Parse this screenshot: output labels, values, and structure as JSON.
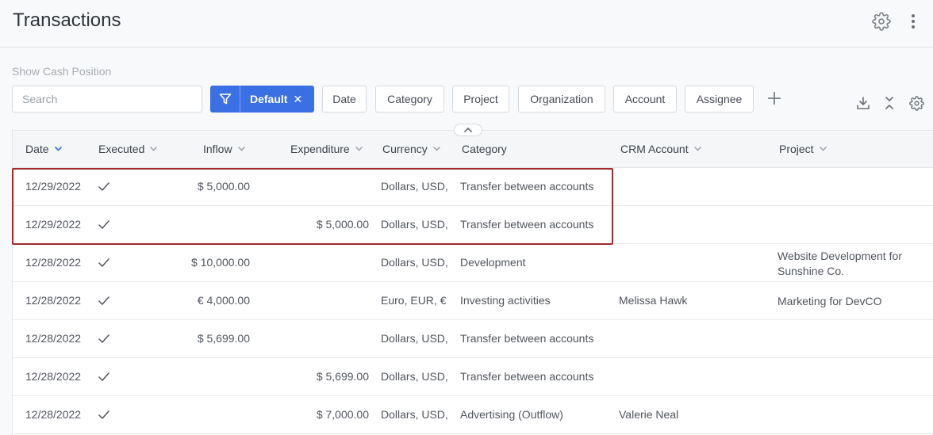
{
  "header": {
    "title": "Transactions",
    "settings_icon": "gear-icon",
    "more_icon": "more-vertical-icon"
  },
  "toolbar": {
    "show_cash_position": "Show Cash Position",
    "search_placeholder": "Search",
    "default_filter": "Default",
    "filter_chips": [
      "Date",
      "Category",
      "Project",
      "Organization",
      "Account",
      "Assignee"
    ],
    "accent_color": "#3b6fe4"
  },
  "table": {
    "columns": {
      "date": "Date",
      "executed": "Executed",
      "inflow": "Inflow",
      "expenditure": "Expenditure",
      "currency": "Currency",
      "category": "Category",
      "crm_account": "CRM Account",
      "project": "Project"
    },
    "rows": [
      {
        "date": "12/29/2022",
        "executed": true,
        "inflow": "$ 5,000.00",
        "expenditure": "",
        "currency": "Dollars, USD,",
        "category": "Transfer between accounts",
        "crm_account": "",
        "project": "",
        "highlighted": true
      },
      {
        "date": "12/29/2022",
        "executed": true,
        "inflow": "",
        "expenditure": "$ 5,000.00",
        "currency": "Dollars, USD,",
        "category": "Transfer between accounts",
        "crm_account": "",
        "project": "",
        "highlighted": true
      },
      {
        "date": "12/28/2022",
        "executed": true,
        "inflow": "$ 10,000.00",
        "expenditure": "",
        "currency": "Dollars, USD,",
        "category": "Development",
        "crm_account": "",
        "project": "Website Development for Sunshine Co."
      },
      {
        "date": "12/28/2022",
        "executed": true,
        "inflow": "€ 4,000.00",
        "expenditure": "",
        "currency": "Euro, EUR, €",
        "category": "Investing activities",
        "crm_account": "Melissa Hawk",
        "project": "Marketing for DevCO"
      },
      {
        "date": "12/28/2022",
        "executed": true,
        "inflow": "$ 5,699.00",
        "expenditure": "",
        "currency": "Dollars, USD,",
        "category": "Transfer between accounts",
        "crm_account": "",
        "project": ""
      },
      {
        "date": "12/28/2022",
        "executed": true,
        "inflow": "",
        "expenditure": "$ 5,699.00",
        "currency": "Dollars, USD,",
        "category": "Transfer between accounts",
        "crm_account": "",
        "project": ""
      },
      {
        "date": "12/28/2022",
        "executed": true,
        "inflow": "",
        "expenditure": "$ 7,000.00",
        "currency": "Dollars, USD,",
        "category": "Advertising (Outflow)",
        "crm_account": "Valerie Neal",
        "project": ""
      }
    ]
  }
}
